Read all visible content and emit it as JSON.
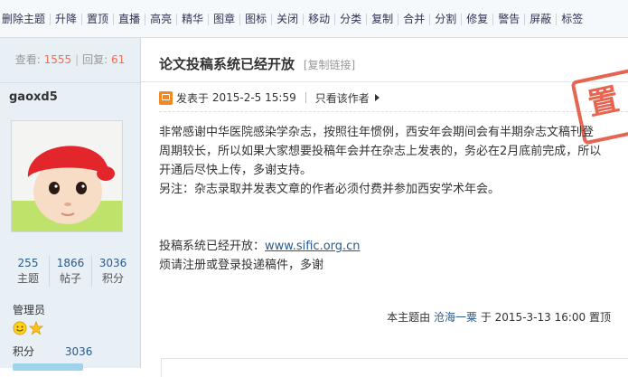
{
  "toolbar": {
    "items": [
      "删除主题",
      "升降",
      "置顶",
      "直播",
      "高亮",
      "精华",
      "图章",
      "图标",
      "关闭",
      "移动",
      "分类",
      "复制",
      "合并",
      "分割",
      "修复",
      "警告",
      "屏蔽",
      "标签"
    ]
  },
  "sidebar": {
    "stats": {
      "views_label": "查看:",
      "views": "1555",
      "replies_label": "回复:",
      "replies": "61"
    },
    "username": "gaoxd5",
    "counts": [
      {
        "value": "255",
        "label": "主题"
      },
      {
        "value": "1866",
        "label": "帖子"
      },
      {
        "value": "3036",
        "label": "积分"
      }
    ],
    "group": "管理员",
    "points_label": "积分",
    "points_value": "3036"
  },
  "post": {
    "title": "论文投稿系统已经开放",
    "copy_link": "[复制链接]",
    "posted_label": "发表于",
    "posted_time": "2015-2-5 15:59",
    "only_author": "只看该作者",
    "stamp_text": "置",
    "lines": [
      "非常感谢中华医院感染学杂志，按照往年惯例，西安年会期间会有半期杂志文稿刊登",
      "周期较长，所以如果大家想要投稿年会并在杂志上发表的，务必在2月底前完成，所以",
      "开通后尽快上传，多谢支持。",
      "另注：杂志录取并发表文章的作者必须付费并参加西安学术年会。"
    ],
    "system_open_label": "投稿系统已经开放：",
    "system_url": "www.sific.org.cn",
    "register_line": "烦请注册或登录投递稿件，多谢",
    "footnote": {
      "prefix": "本主题由",
      "user": "沧海一粟",
      "mid": "于",
      "time": "2015-3-13 16:00",
      "action": "置顶"
    }
  },
  "colors": {
    "accent": "#f26c4f",
    "link": "#2b5a8a",
    "stamp": "#e24b33",
    "sidebar_bg": "#e8eff5"
  }
}
